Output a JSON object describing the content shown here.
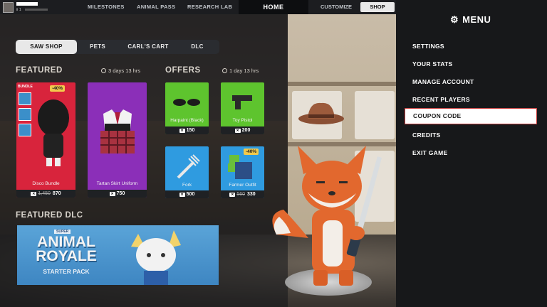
{
  "topbar": {
    "player_level": "Ⅱ 1",
    "nav": [
      "MILESTONES",
      "ANIMAL PASS",
      "RESEARCH LAB"
    ],
    "home": "HOME",
    "customize": "CUSTOMIZE",
    "shop": "SHOP"
  },
  "shop_tabs": [
    "SAW SHOP",
    "PETS",
    "CARL'S CART",
    "DLC"
  ],
  "featured": {
    "title": "FEATURED",
    "timer": "3 days 13 hrs",
    "items": [
      {
        "tag": "BUNDLE",
        "badge": "-40%",
        "name": "Disco Bundle",
        "old_price": "1,450",
        "price": "870",
        "color": "#d8243c"
      },
      {
        "name": "Tartan Skirt Uniform",
        "price": "750",
        "color": "#8b2fb8"
      }
    ]
  },
  "offers": {
    "title": "OFFERS",
    "timer": "1 day 13 hrs",
    "items": [
      {
        "name": "Harpaint (Black)",
        "price": "150",
        "color": "#5ec42e"
      },
      {
        "name": "Toy Pistol",
        "price": "200",
        "color": "#5ec42e"
      },
      {
        "name": "Fork",
        "price": "500",
        "color": "#2f9be0"
      },
      {
        "badge": "-40%",
        "name": "Farmer Outfit",
        "old_price": "560",
        "price": "330",
        "color": "#2f9be0"
      }
    ]
  },
  "featured_dlc": {
    "title": "FEATURED DLC",
    "pre": "SUPER",
    "name_line1": "ANIMAL",
    "name_line2": "ROYALE",
    "subtitle": "STARTER PACK"
  },
  "menu": {
    "title": "MENU",
    "items": [
      "SETTINGS",
      "YOUR STATS",
      "MANAGE ACCOUNT",
      "RECENT PLAYERS",
      "COUPON CODE",
      "CREDITS",
      "EXIT GAME"
    ],
    "highlighted": "COUPON CODE"
  }
}
